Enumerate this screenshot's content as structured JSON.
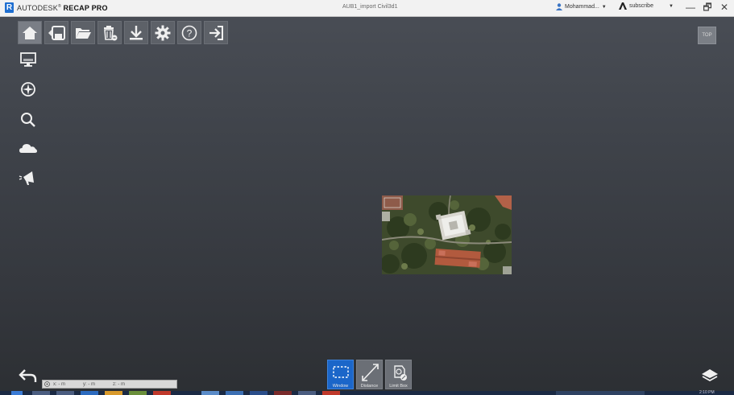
{
  "titlebar": {
    "brand_prefix": "AUTODESK",
    "brand_product": "RECAP PRO",
    "file_name": "AUB1_import Civil3d1",
    "user_name": "Mohammad...",
    "subscribe_label": "subscribe",
    "minimize": "—",
    "restore": "🗗",
    "close": "✕"
  },
  "toolbar": {
    "items": [
      {
        "name": "home",
        "icon": "home-icon"
      },
      {
        "name": "save",
        "icon": "save-icon"
      },
      {
        "name": "open",
        "icon": "folder-icon"
      },
      {
        "name": "delete",
        "icon": "trash-icon"
      },
      {
        "name": "export",
        "icon": "download-icon"
      },
      {
        "name": "settings",
        "icon": "gear-icon"
      },
      {
        "name": "help",
        "icon": "help-icon"
      },
      {
        "name": "exit",
        "icon": "exit-icon"
      }
    ]
  },
  "view_cube": {
    "label": "TOP"
  },
  "left_tools": [
    {
      "name": "display-settings",
      "icon": "monitor-icon"
    },
    {
      "name": "navigation",
      "icon": "compass-icon"
    },
    {
      "name": "search",
      "icon": "magnifier-icon"
    },
    {
      "name": "cloud",
      "icon": "cloud-icon"
    },
    {
      "name": "annotate",
      "icon": "megaphone-icon"
    }
  ],
  "coordinates": {
    "x": "x: - m",
    "y": "y: - m",
    "z": "z: - m"
  },
  "selection_tools": [
    {
      "label": "Window",
      "icon": "window-select-icon",
      "active": true
    },
    {
      "label": "Distance",
      "icon": "distance-icon",
      "active": false
    },
    {
      "label": "Limit Box",
      "icon": "limit-box-icon",
      "active": false
    }
  ],
  "taskbar": {
    "clock": "2:10 PM"
  },
  "colors": {
    "accent": "#1b66c9",
    "background_top": "#4a4e56",
    "background_bottom": "#2c2f33"
  }
}
